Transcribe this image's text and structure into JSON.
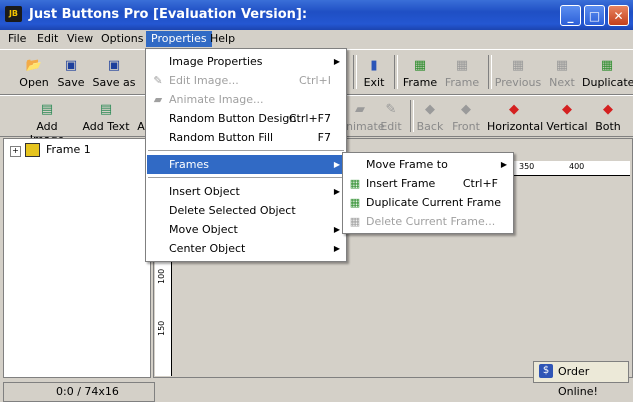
{
  "window": {
    "title": "Just Buttons Pro [Evaluation Version]:",
    "app_icon": "JB"
  },
  "menubar": {
    "file": "File",
    "edit": "Edit",
    "view": "View",
    "options": "Options",
    "properties": "Properties",
    "help": "Help"
  },
  "toolbar1": {
    "open": "Open",
    "save": "Save",
    "save_as": "Save as",
    "exit": "Exit",
    "frame": "Frame",
    "frame_disabled": "Frame",
    "previous": "Previous",
    "next": "Next",
    "duplicate": "Duplicate"
  },
  "toolbar2": {
    "add_image": "Add Image",
    "add_text": "Add Text",
    "add_other": "A",
    "animate": "nimate",
    "edit": "Edit",
    "back": "Back",
    "front": "Front",
    "horizontal": "Horizontal",
    "vertical": "Vertical",
    "both": "Both"
  },
  "tree": {
    "expander": "+",
    "frame1": "Frame 1"
  },
  "ruler": {
    "top_350": "350",
    "top_400": "400",
    "left_100": "100",
    "left_150": "150"
  },
  "status": {
    "position": "0:0 / 74x16"
  },
  "order_online": "Order Online!",
  "properties_menu": {
    "image_properties": "Image Properties",
    "edit_image": "Edit Image...",
    "edit_image_sc": "Ctrl+I",
    "animate_image": "Animate Image...",
    "random_button_design": "Random Button Design",
    "random_button_design_sc": "Ctrl+F7",
    "random_button_fill": "Random Button Fill",
    "random_button_fill_sc": "F7",
    "frames": "Frames",
    "insert_object": "Insert Object",
    "delete_selected_object": "Delete Selected Object",
    "move_object": "Move Object",
    "center_object": "Center Object"
  },
  "frames_menu": {
    "move_frame_to": "Move Frame to",
    "insert_frame": "Insert Frame",
    "insert_frame_sc": "Ctrl+F",
    "duplicate_current_frame": "Duplicate Current Frame",
    "delete_current_frame": "Delete Current Frame..."
  },
  "colors": {
    "menu_highlight": "#316ac5",
    "titlebar": "#2457d2",
    "face": "#d4d0c8"
  }
}
